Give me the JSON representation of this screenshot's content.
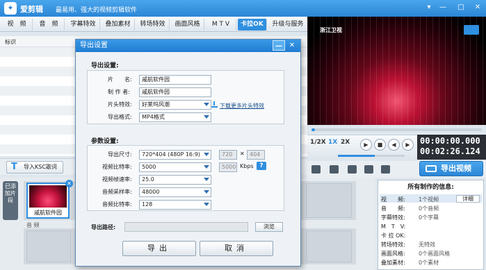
{
  "app": {
    "logo_glyph": "✦",
    "title": "爱剪辑",
    "slogan": "最易用、强大的视频剪辑软件",
    "window_controls": [
      "▾",
      "—",
      "□",
      "✕"
    ]
  },
  "tabs": [
    {
      "label": "视　频",
      "active": false
    },
    {
      "label": "音　频",
      "active": false
    },
    {
      "label": "字幕特效",
      "active": false
    },
    {
      "label": "叠加素材",
      "active": false
    },
    {
      "label": "转场特效",
      "active": false
    },
    {
      "label": "画面风格",
      "active": false
    },
    {
      "label": "M T V",
      "active": false
    },
    {
      "label": "卡拉OK",
      "active": true
    },
    {
      "label": "升级与服务",
      "active": false
    }
  ],
  "list": {
    "header": "标识"
  },
  "ksc_button": {
    "icon": "T",
    "label": "导入KSC歌词"
  },
  "timeline": {
    "side_label": "已添加片段",
    "clip_name": "戚航软件园",
    "clip_close": "✕",
    "audio_label": "音 频"
  },
  "player": {
    "watermark": "浙江卫视",
    "progress_fraction": 0.02,
    "volume_fraction": 0.55,
    "speeds": [
      {
        "label": "1/2X",
        "active": false
      },
      {
        "label": "1X",
        "active": true
      },
      {
        "label": "2X",
        "active": false
      }
    ],
    "buttons": [
      "▶",
      "■",
      "◀",
      "▶"
    ],
    "time_current": "00:00:00.000",
    "time_total": "00:02:26.124"
  },
  "export_button": "导出视频",
  "info": {
    "title": "所有制作的信息:",
    "detail_button": "详细",
    "rows": [
      {
        "key": "视　　频:",
        "value": "1个视频"
      },
      {
        "key": "音　　频:",
        "value": "0个音频"
      },
      {
        "key": "字幕特效:",
        "value": "0个字幕"
      },
      {
        "key": "M　T　V:",
        "value": ""
      },
      {
        "key": "卡 拉 OK:",
        "value": ""
      },
      {
        "key": "转场特效:",
        "value": "无特效"
      },
      {
        "key": "画面风格:",
        "value": "0个画面风格"
      },
      {
        "key": "叠加素材:",
        "value": "0个素材"
      }
    ]
  },
  "dialog": {
    "title": "导出设置",
    "minimize": "—",
    "close": "✕",
    "export_section": "导出设置:",
    "name_label": "片　　名:",
    "name_value": "戚航软件园",
    "author_label": "制 作 者:",
    "author_value": "戚航软件园",
    "intro_label": "片头特效:",
    "intro_value": "好莱坞风潮",
    "format_label": "导出格式:",
    "format_value": "MP4格式",
    "download_link": "下载更多片头特效",
    "params_section": "参数设置:",
    "size_label": "导出尺寸:",
    "size_value": "720*404 (480P 16:9)",
    "size_w": "720",
    "size_x": "✕",
    "size_h": "404",
    "vbitrate_label": "视频比特率:",
    "vbitrate_value": "5000",
    "vbitrate_custom": "5000",
    "vbitrate_unit": "Kbps",
    "help": "?",
    "fps_label": "视频帧速率:",
    "fps_value": "25.0",
    "asample_label": "音频采样率:",
    "asample_value": "48000",
    "abitrate_label": "音频比特率:",
    "abitrate_value": "128",
    "path_label": "导出路径:",
    "browse_button": "浏览",
    "ok_button": "导出",
    "cancel_button": "取消"
  }
}
